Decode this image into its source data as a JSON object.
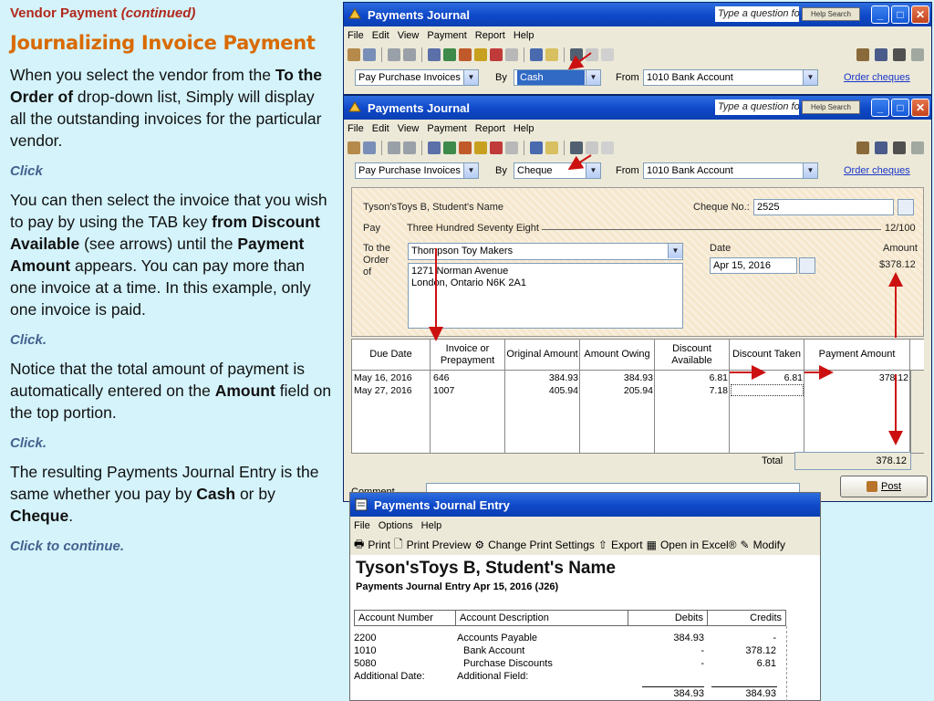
{
  "left": {
    "header_a": "Vendor Payment",
    "header_b": "(continued)",
    "title": "Journalizing Invoice Payment",
    "p1_a": "When you select the vendor from the ",
    "p1_b": "To the Order of",
    "p1_c": " drop-down list, Simply will display all the outstanding invoices for the particular vendor.",
    "click1": "Click",
    "p2_a": "You can then select the invoice that you wish to pay by using the TAB key ",
    "p2_b": "from Discount Available",
    "p2_c": " (see arrows) until the ",
    "p2_d": "Payment Amount",
    "p2_e": " appears. You can pay more than one invoice at a time. In this example, only one invoice is paid.",
    "click2": "Click.",
    "p3_a": "Notice that the total amount of payment is automatically entered on the ",
    "p3_b": "Amount",
    "p3_c": " field on the top portion.",
    "click3": "Click.",
    "p4_a": "The resulting Payments Journal Entry is the same whether you pay by ",
    "p4_b": "Cash",
    "p4_c": " or by ",
    "p4_d": "Cheque",
    "p4_e": ".",
    "click4": "Click to continue."
  },
  "win1": {
    "title": "Payments Journal",
    "question": "Type a question fo",
    "help_search": "Help Search",
    "menu": [
      "File",
      "Edit",
      "View",
      "Payment",
      "Report",
      "Help"
    ],
    "pay_type": "Pay Purchase Invoices",
    "by_label": "By",
    "by_value": "Cash",
    "from_label": "From",
    "from_value": "1010 Bank Account",
    "order_link": "Order cheques"
  },
  "win2": {
    "title": "Payments Journal",
    "question": "Type a question fo",
    "help_search": "Help Search",
    "menu": [
      "File",
      "Edit",
      "View",
      "Payment",
      "Report",
      "Help"
    ],
    "pay_type": "Pay Purchase Invoices",
    "by_label": "By",
    "by_value": "Cheque",
    "from_label": "From",
    "from_value": "1010 Bank Account",
    "order_link": "Order cheques",
    "cheque": {
      "company": "Tyson'sToys B, Student's Name",
      "cheque_no_label": "Cheque No.:",
      "cheque_no": "2525",
      "pay_label": "Pay",
      "pay_words": "Three Hundred Seventy Eight",
      "pay_cents": "12/100",
      "to_order_l1": "To the",
      "to_order_l2": "Order",
      "to_order_l3": "of",
      "vendor": "Thompson Toy Makers",
      "addr1": "1271 Norman Avenue",
      "addr2": "London, Ontario N6K 2A1",
      "date_label": "Date",
      "date": "Apr 15, 2016",
      "amount_label": "Amount",
      "amount": "$378.12"
    },
    "grid": {
      "headers": [
        "Due Date",
        "Invoice or Prepayment",
        "Original Amount",
        "Amount Owing",
        "Discount Available",
        "Discount Taken",
        "Payment Amount"
      ],
      "rows": [
        [
          "May 16, 2016",
          "646",
          "384.93",
          "384.93",
          "6.81",
          "6.81",
          "378.12"
        ],
        [
          "May 27, 2016",
          "1007",
          "405.94",
          "205.94",
          "7.18",
          "",
          ""
        ]
      ]
    },
    "total_label": "Total",
    "total": "378.12",
    "post": "Post",
    "comment_label": "Comment"
  },
  "win3": {
    "title": "Payments Journal Entry",
    "menu": [
      "File",
      "Options",
      "Help"
    ],
    "toolbar": [
      "Print",
      "Print Preview",
      "Change Print Settings",
      "Export",
      "Open in Excel®",
      "Modify"
    ],
    "company": "Tyson'sToys B, Student's Name",
    "subtitle": "Payments Journal Entry Apr 15, 2016 (J26)",
    "headers": [
      "Account Number",
      "Account Description",
      "Debits",
      "Credits"
    ],
    "rows": [
      [
        "2200",
        "Accounts Payable",
        "384.93",
        "-"
      ],
      [
        "1010",
        "Bank Account",
        "-",
        "378.12"
      ],
      [
        "5080",
        "Purchase Discounts",
        "-",
        "6.81"
      ]
    ],
    "additional_date": "Additional Date:",
    "additional_field": "Additional Field:",
    "total_debits": "384.93",
    "total_credits": "384.93"
  }
}
